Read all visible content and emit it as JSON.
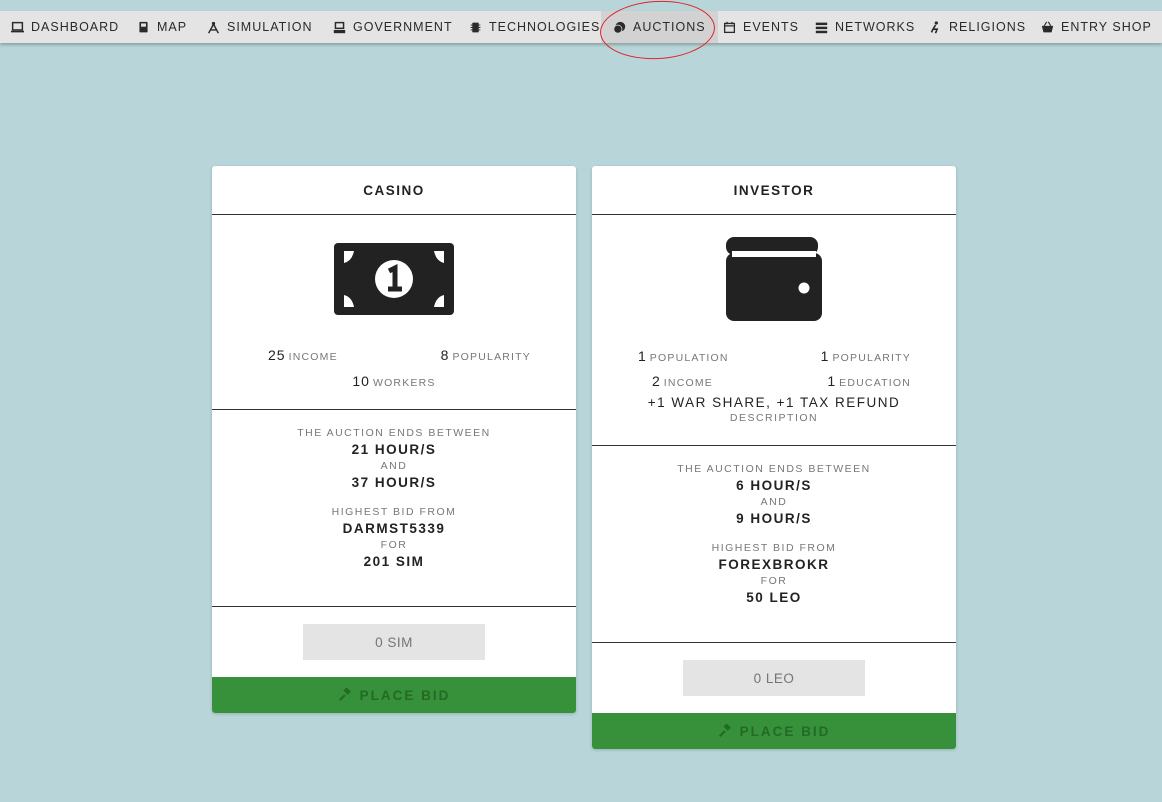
{
  "nav": {
    "items": [
      {
        "label": "DASHBOARD",
        "icon": "laptop-icon"
      },
      {
        "label": "MAP",
        "icon": "book-icon"
      },
      {
        "label": "SIMULATION",
        "icon": "compass-icon"
      },
      {
        "label": "GOVERNMENT",
        "icon": "ballot-box-icon"
      },
      {
        "label": "TECHNOLOGIES",
        "icon": "chip-icon"
      },
      {
        "label": "AUCTIONS",
        "icon": "coins-icon"
      },
      {
        "label": "EVENTS",
        "icon": "calendar-icon"
      },
      {
        "label": "NETWORKS",
        "icon": "server-icon"
      },
      {
        "label": "RELIGIONS",
        "icon": "praying-icon"
      },
      {
        "label": "ENTRY SHOP",
        "icon": "basket-icon"
      }
    ],
    "active": "AUCTIONS",
    "annotation_color": "#e0242b"
  },
  "cards": [
    {
      "title": "CASINO",
      "icon": "money-bill-icon",
      "stats": [
        {
          "value": "25",
          "label": "INCOME"
        },
        {
          "value": "8",
          "label": "POPULARITY"
        },
        {
          "value": "10",
          "label": "WORKERS"
        }
      ],
      "auction_ends_label": "THE AUCTION ENDS BETWEEN",
      "ends_min": "21 HOUR/S",
      "and_label": "AND",
      "ends_max": "37 HOUR/S",
      "highest_bid_label": "HIGHEST BID FROM",
      "bidder": "DARMST5339",
      "for_label": "FOR",
      "bid_amount": "201 SIM",
      "bid_placeholder": "0 SIM",
      "button_label": "PLACE BID"
    },
    {
      "title": "INVESTOR",
      "icon": "wallet-icon",
      "stats": [
        {
          "value": "1",
          "label": "POPULATION"
        },
        {
          "value": "1",
          "label": "POPULARITY"
        },
        {
          "value": "2",
          "label": "INCOME"
        },
        {
          "value": "1",
          "label": "EDUCATION"
        }
      ],
      "description_value": "+1 WAR SHARE, +1 TAX REFUND",
      "description_label": "DESCRIPTION",
      "auction_ends_label": "THE AUCTION ENDS BETWEEN",
      "ends_min": "6 HOUR/S",
      "and_label": "AND",
      "ends_max": "9 HOUR/S",
      "highest_bid_label": "HIGHEST BID FROM",
      "bidder": "FOREXBROKR",
      "for_label": "FOR",
      "bid_amount": "50 LEO",
      "bid_placeholder": "0 LEO",
      "button_label": "PLACE BID"
    }
  ],
  "colors": {
    "background": "#b8d6d9",
    "button_green": "#37913b",
    "button_text": "#236a25"
  }
}
